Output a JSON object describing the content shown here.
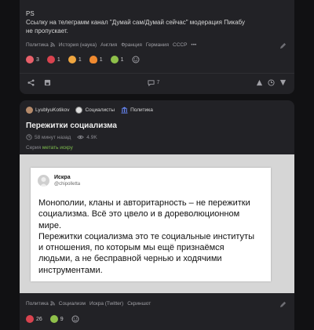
{
  "post1": {
    "ps": "PS",
    "text_line1": "Ссылку на телеграмм канал \"Думай сам/Думай сейчас\" модерация Пикабу",
    "text_line2": "не пропускает.",
    "tags": [
      "Политика",
      "История (наука)",
      "Англия",
      "Франция",
      "Германия",
      "СССР"
    ],
    "more": "•••",
    "reactions": [
      {
        "icon": "laughing-face-icon",
        "count": "3",
        "color": "#e8606a"
      },
      {
        "icon": "angry-face-icon",
        "count": "1",
        "color": "#d9434f"
      },
      {
        "icon": "clapping-hands-icon",
        "count": "1",
        "color": "#f0a640"
      },
      {
        "icon": "fire-icon",
        "count": "1",
        "color": "#f08a30"
      },
      {
        "icon": "vomiting-face-icon",
        "count": "1",
        "color": "#8fc04a"
      }
    ],
    "comments_count": "7"
  },
  "post2": {
    "author": "LyublyuKotikov",
    "community": "Социалисты",
    "category": "Политика",
    "title": "Пережитки социализма",
    "time": "58 минут назад",
    "views": "4.9K",
    "series_label": "Серия",
    "series_link": "метать искру",
    "tweet": {
      "name": "Искра",
      "handle": "@chipolletta",
      "line1": "Монополии, кланы и авторитарность – не пережитки",
      "line2": "социализма. Всё это цвело и в дореволюционном",
      "line3": "мире.",
      "line4": "Пережитки социализма это те социальные институты",
      "line5": "и отношения, по которым мы ещё признаёмся",
      "line6": "людьми, а не бесправной чернью и ходячими",
      "line7": "инструментами."
    },
    "tags": [
      "Политика",
      "Социализм",
      "Искра (Twitter)",
      "Скриншот"
    ],
    "reactions": [
      {
        "icon": "angry-face-icon",
        "count": "26",
        "color": "#d9434f"
      },
      {
        "icon": "vomiting-face-icon",
        "count": "9",
        "color": "#8fc04a"
      }
    ]
  },
  "colors": {
    "accent": "#7fbf4e",
    "card": "#222226",
    "background": "#111113"
  }
}
